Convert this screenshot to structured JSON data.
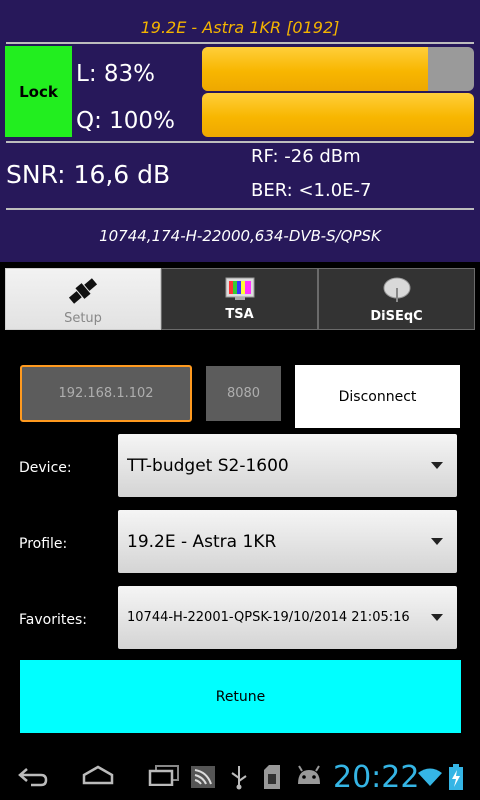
{
  "status": {
    "satellite": "19.2E - Astra 1KR [0192]",
    "lock": "Lock",
    "level_label": "L: 83%",
    "level_fraction": 0.83,
    "quality_label": "Q: 100%",
    "quality_fraction": 1.0,
    "snr": "SNR: 16,6 dB",
    "rf": "RF: -26 dBm",
    "ber": "BER: <1.0E-7",
    "transponder": "10744,174-H-22000,634-DVB-S/QPSK",
    "colors": {
      "panel": "#27185a",
      "title": "#f4b400",
      "lock": "#22ee1f",
      "bar": "#f8b600"
    }
  },
  "tabs": [
    {
      "label": "Setup",
      "icon": "satellite-icon",
      "active": true
    },
    {
      "label": "TSA",
      "icon": "tv-monitor-icon",
      "active": false
    },
    {
      "label": "DiSEqC",
      "icon": "dish-icon",
      "active": false
    }
  ],
  "connection": {
    "ip_value": "192.168.1.102",
    "port_value": "8080",
    "disconnect_label": "Disconnect"
  },
  "form": {
    "device_label": "Device:",
    "device_value": "TT-budget S2-1600",
    "profile_label": "Profile:",
    "profile_value": "19.2E - Astra 1KR",
    "favorites_label": "Favorites:",
    "favorites_value": "10744-H-22001-QPSK-19/10/2014 21:05:16"
  },
  "retune_label": "Retune",
  "system_bar": {
    "time": "20:22",
    "accent": "#35b5e5",
    "icons": [
      "back-icon",
      "home-icon",
      "recent-apps-icon",
      "signal-app-icon",
      "usb-icon",
      "sd-card-icon",
      "android-debug-icon",
      "wifi-icon",
      "battery-charging-icon"
    ]
  }
}
